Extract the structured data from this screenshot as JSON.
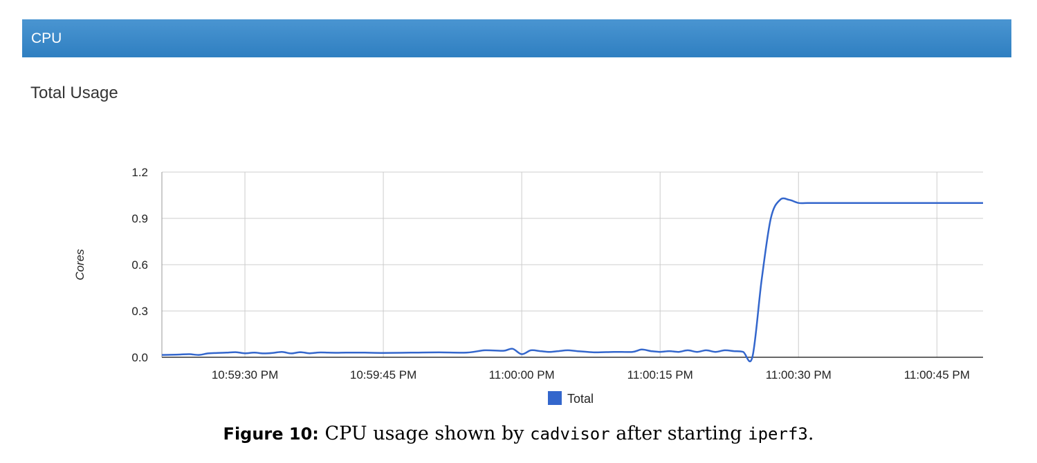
{
  "panel": {
    "title": "CPU"
  },
  "section": {
    "title": "Total Usage"
  },
  "chart_data": {
    "type": "line",
    "title": "",
    "xlabel": "",
    "ylabel": "Cores",
    "ylim": [
      0,
      1.2
    ],
    "yticks": [
      0.0,
      0.3,
      0.6,
      0.9,
      1.2
    ],
    "ytick_labels": [
      "0.0",
      "0.3",
      "0.6",
      "0.9",
      "1.2"
    ],
    "xlim": [
      "10:59:21 PM",
      "11:00:50 PM"
    ],
    "xticks": [
      "10:59:30 PM",
      "10:59:45 PM",
      "11:00:00 PM",
      "11:00:15 PM",
      "11:00:30 PM",
      "11:00:45 PM"
    ],
    "grid": true,
    "legend_position": "bottom",
    "series": [
      {
        "name": "Total",
        "color": "#3366cc",
        "x": [
          "10:59:21 PM",
          "10:59:22 PM",
          "10:59:23 PM",
          "10:59:24 PM",
          "10:59:25 PM",
          "10:59:26 PM",
          "10:59:27 PM",
          "10:59:28 PM",
          "10:59:29 PM",
          "10:59:30 PM",
          "10:59:31 PM",
          "10:59:32 PM",
          "10:59:33 PM",
          "10:59:34 PM",
          "10:59:35 PM",
          "10:59:36 PM",
          "10:59:37 PM",
          "10:59:38 PM",
          "10:59:39 PM",
          "10:59:40 PM",
          "10:59:41 PM",
          "10:59:43 PM",
          "10:59:45 PM",
          "10:59:48 PM",
          "10:59:51 PM",
          "10:59:54 PM",
          "10:59:56 PM",
          "10:59:58 PM",
          "10:59:59 PM",
          "11:00:00 PM",
          "11:00:01 PM",
          "11:00:02 PM",
          "11:00:03 PM",
          "11:00:04 PM",
          "11:00:05 PM",
          "11:00:06 PM",
          "11:00:08 PM",
          "11:00:10 PM",
          "11:00:12 PM",
          "11:00:13 PM",
          "11:00:14 PM",
          "11:00:15 PM",
          "11:00:16 PM",
          "11:00:17 PM",
          "11:00:18 PM",
          "11:00:19 PM",
          "11:00:20 PM",
          "11:00:21 PM",
          "11:00:22 PM",
          "11:00:23 PM",
          "11:00:24 PM",
          "11:00:25 PM",
          "11:00:26 PM",
          "11:00:27 PM",
          "11:00:28 PM",
          "11:00:29 PM",
          "11:00:30 PM",
          "11:00:31 PM",
          "11:00:32 PM",
          "11:00:33 PM",
          "11:00:34 PM",
          "11:00:35 PM",
          "11:00:36 PM",
          "11:00:40 PM",
          "11:00:45 PM",
          "11:00:50 PM"
        ],
        "y": [
          0.015,
          0.016,
          0.018,
          0.02,
          0.015,
          0.025,
          0.028,
          0.03,
          0.033,
          0.026,
          0.03,
          0.025,
          0.028,
          0.035,
          0.025,
          0.033,
          0.026,
          0.031,
          0.03,
          0.029,
          0.03,
          0.03,
          0.028,
          0.03,
          0.032,
          0.03,
          0.045,
          0.042,
          0.055,
          0.02,
          0.045,
          0.04,
          0.035,
          0.04,
          0.045,
          0.04,
          0.032,
          0.035,
          0.035,
          0.05,
          0.04,
          0.035,
          0.04,
          0.035,
          0.045,
          0.035,
          0.045,
          0.035,
          0.045,
          0.04,
          0.035,
          0.002,
          0.5,
          0.9,
          1.02,
          1.02,
          1.0,
          1.0,
          1.0,
          1.0,
          1.0,
          1.0,
          1.0,
          1.0,
          1.0,
          1.0
        ]
      }
    ]
  },
  "caption": {
    "label": "Figure 10:",
    "text_before": "CPU usage shown by",
    "code1": "cadvisor",
    "text_middle": "after starting",
    "code2": "iperf3",
    "text_after": "."
  }
}
